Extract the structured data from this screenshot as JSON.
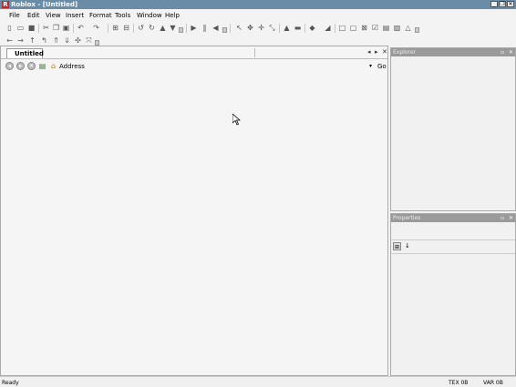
{
  "window": {
    "title": "Roblox - [Untitled]",
    "logo_letter": "R"
  },
  "menu": [
    "File",
    "Edit",
    "View",
    "Insert",
    "Format",
    "Tools",
    "Window",
    "Help"
  ],
  "document": {
    "tab_label": "Untitled",
    "address_label": "Address",
    "go_label": "Go"
  },
  "panels": {
    "explorer_title": "Explorer",
    "properties_title": "Properties"
  },
  "status": {
    "ready": "Ready",
    "tex": "TEX 0B",
    "var": "VAR 0B"
  },
  "icons": {
    "window_controls": [
      "minimize-icon",
      "restore-icon",
      "close-icon"
    ],
    "toolbar1": [
      "new-file-icon",
      "open-folder-icon",
      "save-icon",
      "cut-icon",
      "copy-icon",
      "paste-icon",
      "undo-icon",
      "redo-icon",
      "group-icon",
      "ungroup-icon",
      "rotate-left-icon",
      "rotate-right-icon",
      "tilt-up-icon",
      "tilt-down-icon",
      "play-icon",
      "pause-icon",
      "stop-icon",
      "select-icon",
      "move-icon",
      "resize-icon",
      "scale-icon",
      "lock-icon",
      "anchor-icon",
      "paint-icon",
      "fill-icon",
      "frame-icon",
      "surface-icon",
      "glue-icon",
      "weld-icon",
      "hinge-icon",
      "motor-icon"
    ],
    "toolbar2": [
      "back-arrow-icon",
      "forward-arrow-icon",
      "up-arrow-icon",
      "turn-left-icon",
      "climb-icon",
      "down-arrow-icon",
      "zoom-in-icon",
      "zoom-extents-icon"
    ],
    "nav": [
      "back-circle-icon",
      "forward-circle-icon",
      "stop-circle-icon",
      "page-icon",
      "home-icon"
    ]
  }
}
